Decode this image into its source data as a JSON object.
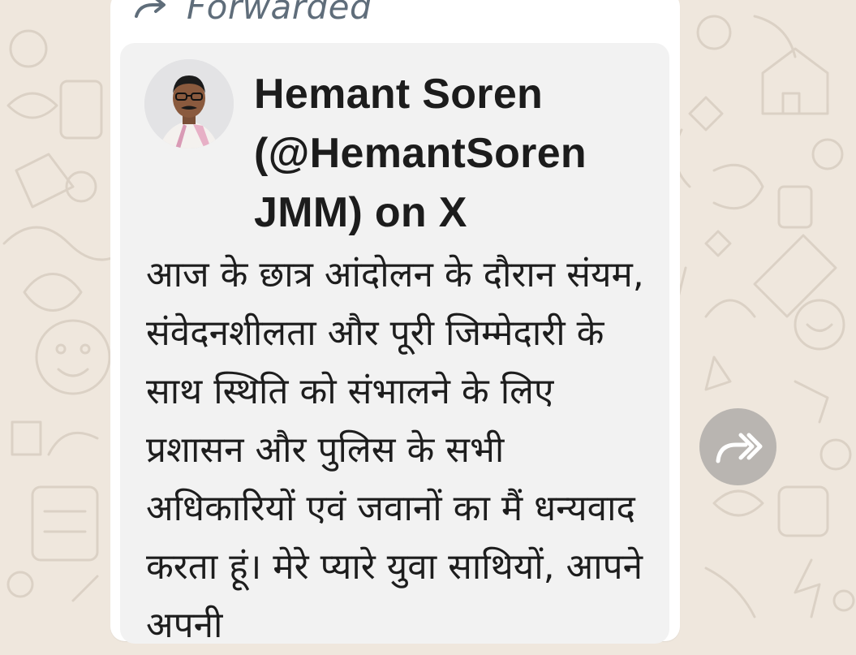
{
  "message": {
    "forwarded_label": "Forwarded",
    "link_preview": {
      "title": "Hemant Soren (@HemantSorenJMM) on X",
      "description": "आज के छात्र आंदोलन के दौरान संयम, संवेदनशीलता और पूरी जिम्मेदारी के साथ स्थिति को संभालने के लिए प्रशासन और पुलिस के सभी अधिकारियों एवं जवानों का मैं धन्यवाद करता हूं। मेरे प्यारे युवा साथियों, आपने अपनी"
    }
  },
  "icons": {
    "forwarded": "forward-arrow-icon",
    "share": "share-forward-icon",
    "avatar": "profile-avatar"
  },
  "colors": {
    "chat_background": "#efe7dd",
    "bubble": "#ffffff",
    "preview_card": "#f2f2f2",
    "text": "#1d1d1d",
    "forwarded_label": "#5f6d7a",
    "share_button": "#8c8c8c"
  }
}
